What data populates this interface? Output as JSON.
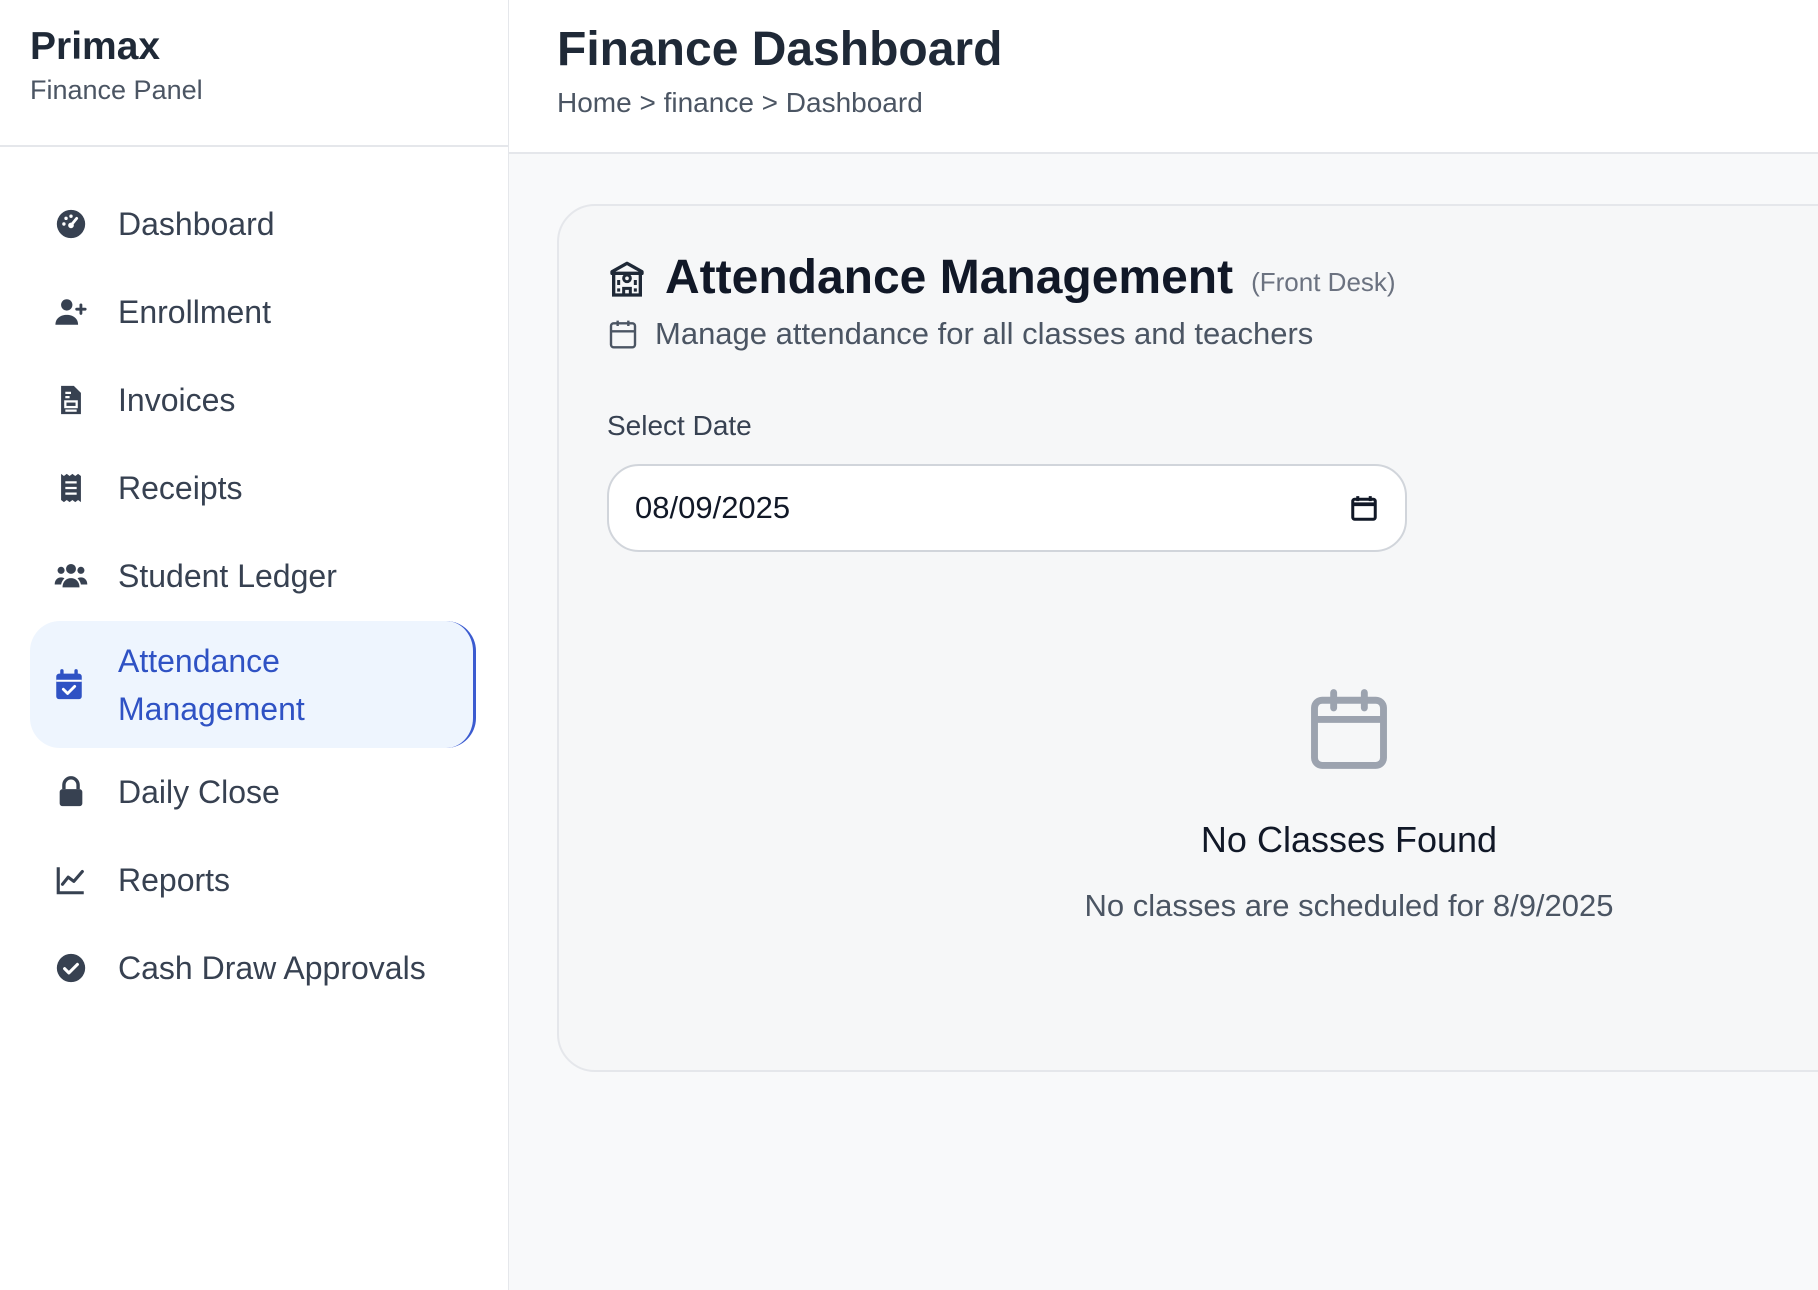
{
  "brand": {
    "name": "Primax",
    "subtitle": "Finance Panel"
  },
  "sidebar": {
    "items": [
      {
        "label": "Dashboard",
        "icon": "gauge-icon",
        "active": false
      },
      {
        "label": "Enrollment",
        "icon": "user-plus-icon",
        "active": false
      },
      {
        "label": "Invoices",
        "icon": "invoice-icon",
        "active": false
      },
      {
        "label": "Receipts",
        "icon": "receipt-icon",
        "active": false
      },
      {
        "label": "Student Ledger",
        "icon": "users-icon",
        "active": false
      },
      {
        "label": "Attendance Management",
        "icon": "calendar-check-icon",
        "active": true
      },
      {
        "label": "Daily Close",
        "icon": "lock-icon",
        "active": false
      },
      {
        "label": "Reports",
        "icon": "chart-line-icon",
        "active": false
      },
      {
        "label": "Cash Draw Approvals",
        "icon": "check-circle-icon",
        "active": false
      }
    ]
  },
  "header": {
    "title": "Finance Dashboard",
    "breadcrumb": "Home > finance > Dashboard"
  },
  "main": {
    "title": "Attendance Management",
    "tag": "(Front Desk)",
    "subtitle": "Manage attendance for all classes and teachers",
    "date_label": "Select Date",
    "date_value": "08/09/2025",
    "empty_title": "No Classes Found",
    "empty_text": "No classes are scheduled for 8/9/2025"
  },
  "colors": {
    "accent": "#2f52c4",
    "active_bg": "#eef5fe",
    "page_bg": "#f8f9fa"
  }
}
